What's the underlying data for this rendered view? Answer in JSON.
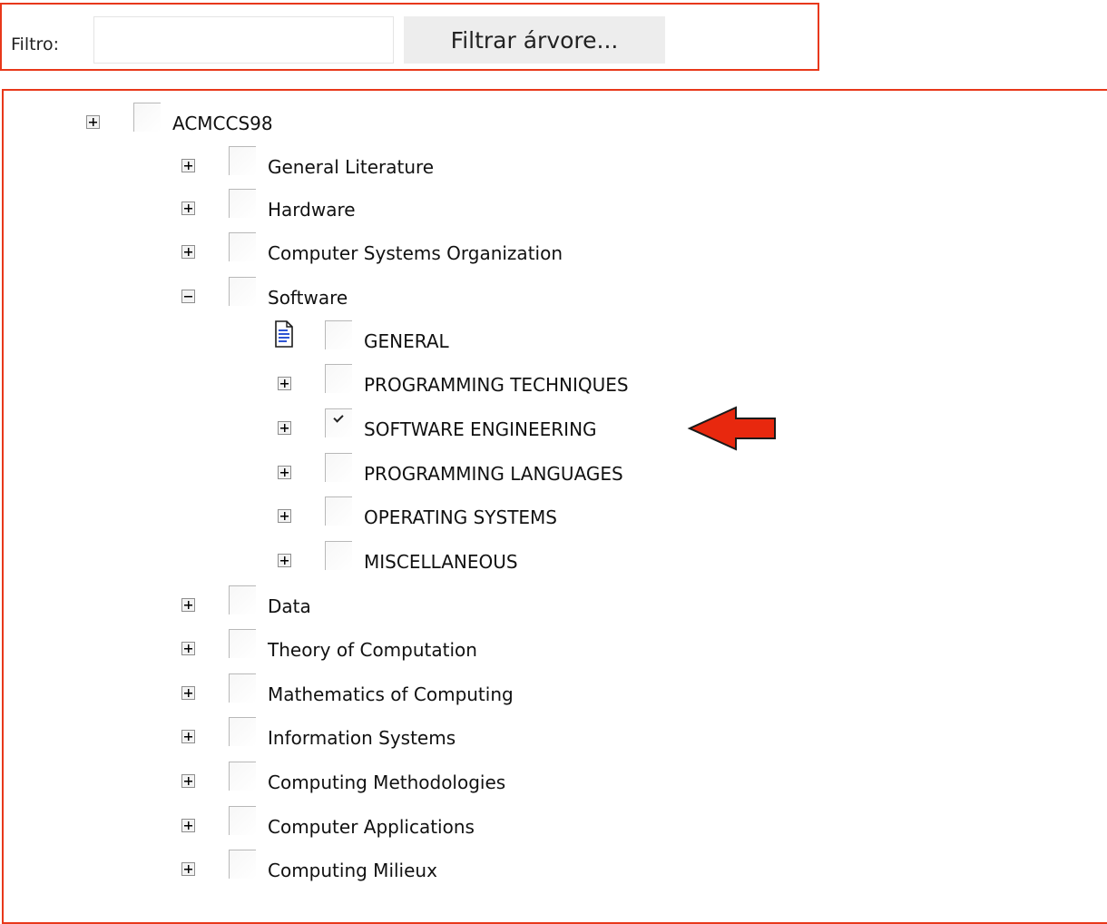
{
  "filter": {
    "label": "Filtro:",
    "input_value": "",
    "input_placeholder": "",
    "button_label": "Filtrar árvore..."
  },
  "tree": {
    "root": {
      "label": "ACMCCS98",
      "expanded": false,
      "checked": false
    },
    "categories": [
      {
        "label": "General Literature",
        "expanded": false,
        "checked": false
      },
      {
        "label": "Hardware",
        "expanded": false,
        "checked": false
      },
      {
        "label": "Computer Systems Organization",
        "expanded": false,
        "checked": false
      },
      {
        "label": "Software",
        "expanded": true,
        "checked": false
      },
      {
        "label": "Data",
        "expanded": false,
        "checked": false
      },
      {
        "label": "Theory of Computation",
        "expanded": false,
        "checked": false
      },
      {
        "label": "Mathematics of Computing",
        "expanded": false,
        "checked": false
      },
      {
        "label": "Information Systems",
        "expanded": false,
        "checked": false
      },
      {
        "label": "Computing Methodologies",
        "expanded": false,
        "checked": false
      },
      {
        "label": "Computer Applications",
        "expanded": false,
        "checked": false
      },
      {
        "label": "Computing Milieux",
        "expanded": false,
        "checked": false
      }
    ],
    "software_children": [
      {
        "label": "GENERAL",
        "leaf": true,
        "checked": false,
        "icon": "document-icon"
      },
      {
        "label": "PROGRAMMING TECHNIQUES",
        "leaf": false,
        "checked": false
      },
      {
        "label": "SOFTWARE ENGINEERING",
        "leaf": false,
        "checked": true
      },
      {
        "label": "PROGRAMMING LANGUAGES",
        "leaf": false,
        "checked": false
      },
      {
        "label": "OPERATING SYSTEMS",
        "leaf": false,
        "checked": false
      },
      {
        "label": "MISCELLANEOUS",
        "leaf": false,
        "checked": false
      }
    ]
  },
  "colors": {
    "highlight_border": "#e8381a",
    "arrow": "#e8280e",
    "button_bg": "#ededed"
  }
}
